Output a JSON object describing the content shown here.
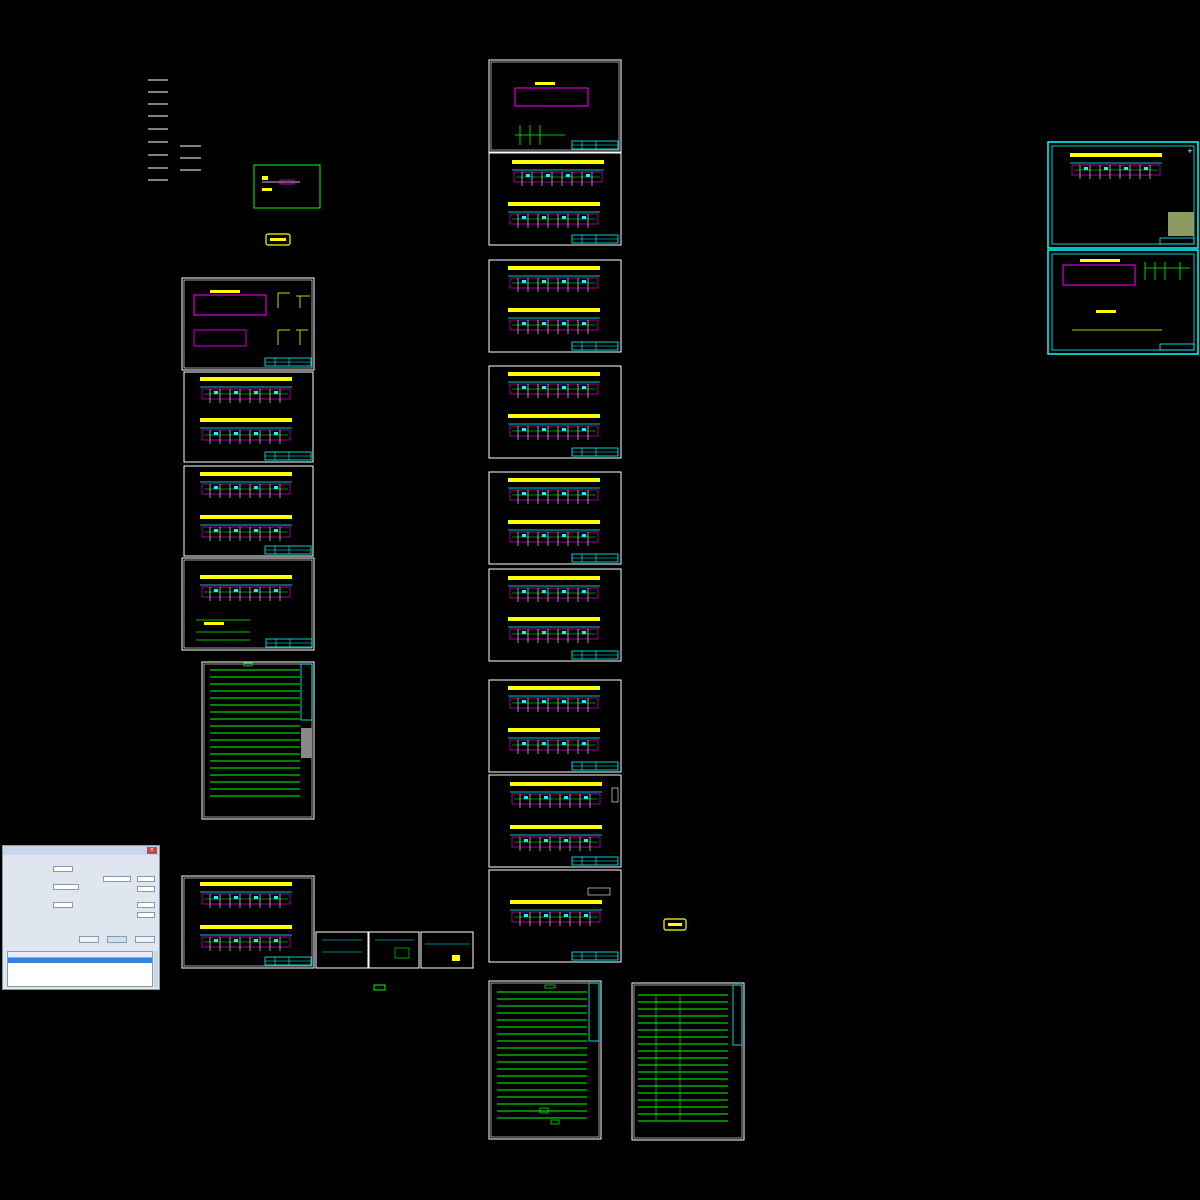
{
  "window": {
    "title": "",
    "close_icon": "close-icon"
  },
  "colors": {
    "background": "#000000",
    "frame": "#ffffff",
    "green": "#00ff00",
    "cyan": "#00ffff",
    "magenta": "#ff00ff",
    "yellow": "#ffff00"
  },
  "drawing_sheets": {
    "column_a": [
      "sheet-a1",
      "sheet-a2",
      "sheet-a3",
      "sheet-a4",
      "sheet-a5-list",
      "sheet-a6"
    ],
    "column_b": [
      "sheet-b1",
      "sheet-b2",
      "sheet-b3",
      "sheet-b4",
      "sheet-b5",
      "sheet-b6",
      "sheet-b7",
      "sheet-b8",
      "sheet-b9",
      "sheet-b10-list",
      "sheet-b11-list"
    ],
    "column_c": [
      "sheet-c1",
      "sheet-c2"
    ]
  },
  "dialog": {
    "buttons": [
      "",
      "",
      ""
    ]
  }
}
